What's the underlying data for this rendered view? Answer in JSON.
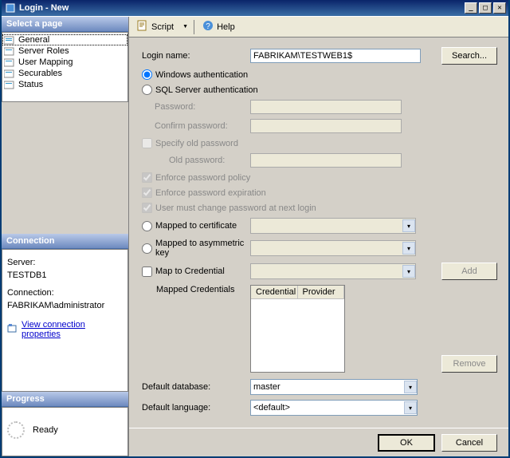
{
  "window": {
    "title": "Login - New"
  },
  "toolbar": {
    "script": "Script",
    "help": "Help"
  },
  "sidebar": {
    "select_page": "Select a page",
    "items": [
      {
        "label": "General",
        "selected": true
      },
      {
        "label": "Server Roles"
      },
      {
        "label": "User Mapping"
      },
      {
        "label": "Securables"
      },
      {
        "label": "Status"
      }
    ],
    "connection": {
      "header": "Connection",
      "server_label": "Server:",
      "server_value": "TESTDB1",
      "connection_label": "Connection:",
      "connection_value": "FABRIKAM\\administrator",
      "view_props": "View connection properties"
    },
    "progress": {
      "header": "Progress",
      "state": "Ready"
    }
  },
  "form": {
    "login_name_label": "Login name:",
    "login_name_value": "FABRIKAM\\TESTWEB1$",
    "search_label": "Search...",
    "auth": {
      "windows": "Windows authentication",
      "sql": "SQL Server authentication"
    },
    "password_label": "Password:",
    "confirm_password_label": "Confirm password:",
    "specify_old_pw": "Specify old password",
    "old_password_label": "Old password:",
    "enforce_policy": "Enforce password policy",
    "enforce_expiration": "Enforce password expiration",
    "must_change": "User must change password at next login",
    "mapped_cert": "Mapped to certificate",
    "mapped_asym": "Mapped to asymmetric key",
    "map_cred": "Map to Credential",
    "add_label": "Add",
    "mapped_creds_label": "Mapped Credentials",
    "cred_col": "Credential",
    "provider_col": "Provider",
    "remove_label": "Remove",
    "default_db_label": "Default database:",
    "default_db_value": "master",
    "default_lang_label": "Default language:",
    "default_lang_value": "<default>"
  },
  "footer": {
    "ok": "OK",
    "cancel": "Cancel"
  }
}
